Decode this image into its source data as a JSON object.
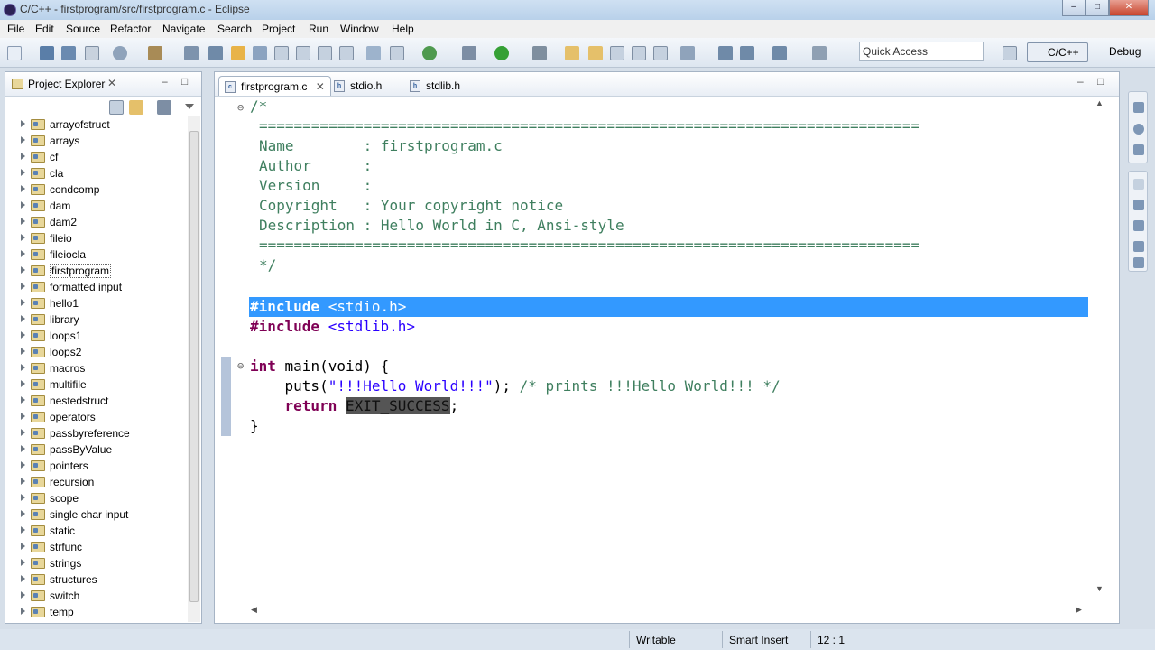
{
  "window": {
    "title": "C/C++ - firstprogram/src/firstprogram.c - Eclipse",
    "minimize": "–",
    "maximize": "□",
    "close": "✕"
  },
  "menu": [
    "File",
    "Edit",
    "Source",
    "Refactor",
    "Navigate",
    "Search",
    "Project",
    "Run",
    "Window",
    "Help"
  ],
  "toolbar": {
    "quick_access": "Quick Access",
    "perspectives": [
      "C/C++",
      "Debug"
    ]
  },
  "project_explorer": {
    "title": "Project Explorer",
    "items": [
      "arrayofstruct",
      "arrays",
      "cf",
      "cla",
      "condcomp",
      "dam",
      "dam2",
      "fileio",
      "fileiocla",
      "firstprogram",
      "formatted input",
      "hello1",
      "library",
      "loops1",
      "loops2",
      "macros",
      "multifile",
      "nestedstruct",
      "operators",
      "passbyreference",
      "passByValue",
      "pointers",
      "recursion",
      "scope",
      "single char input",
      "static",
      "strfunc",
      "strings",
      "structures",
      "switch",
      "temp"
    ],
    "selected": "firstprogram"
  },
  "editor": {
    "tabs": [
      "firstprogram.c",
      "stdio.h",
      "stdlib.h"
    ],
    "active_tab": "firstprogram.c",
    "code": {
      "c_open": "/*",
      "rule": "============================================================================",
      "name": "Name        : firstprogram.c",
      "author": "Author      :",
      "version": "Version     :",
      "copyright": "Copyright   : Your copyright notice",
      "description": "Description : Hello World in C, Ansi-style",
      "c_close": "*/",
      "inc1_kw": "#include",
      "inc1_file": " <stdio.h>",
      "inc2_kw": "#include",
      "inc2_file": " <stdlib.h>",
      "main_kw": "int",
      "main_rest": " main(void) {",
      "puts_fn": "    puts(",
      "puts_str": "\"!!!Hello World!!!\"",
      "puts_end": "); ",
      "puts_comment": "/* prints !!!Hello World!!! */",
      "ret_kw": "    return",
      "ret_space": " ",
      "ret_macro": "EXIT_SUCCESS",
      "ret_end": ";",
      "close_brace": "}"
    }
  },
  "status": {
    "writable": "Writable",
    "insert_mode": "Smart Insert",
    "position": "12 : 1"
  }
}
